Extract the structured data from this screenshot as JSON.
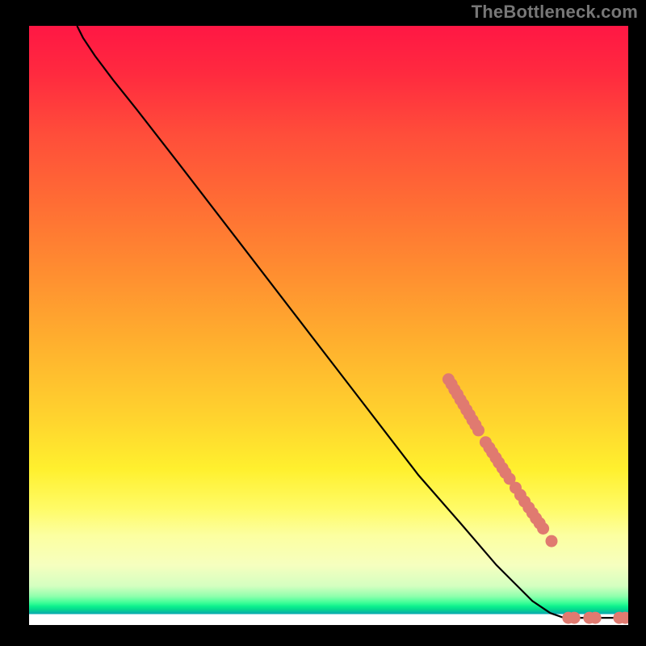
{
  "attribution": "TheBottleneck.com",
  "chart_data": {
    "type": "line",
    "title": "",
    "xlabel": "",
    "ylabel": "",
    "xlim": [
      0,
      100
    ],
    "ylim": [
      0,
      100
    ],
    "grid": false,
    "legend": false,
    "curve": [
      {
        "x": 8,
        "y": 100
      },
      {
        "x": 9,
        "y": 98
      },
      {
        "x": 11,
        "y": 95
      },
      {
        "x": 14,
        "y": 91
      },
      {
        "x": 18,
        "y": 86
      },
      {
        "x": 25,
        "y": 77
      },
      {
        "x": 35,
        "y": 64
      },
      {
        "x": 45,
        "y": 51
      },
      {
        "x": 55,
        "y": 38
      },
      {
        "x": 65,
        "y": 25
      },
      {
        "x": 72,
        "y": 17
      },
      {
        "x": 78,
        "y": 10
      },
      {
        "x": 84,
        "y": 4
      },
      {
        "x": 87,
        "y": 2
      },
      {
        "x": 89,
        "y": 1.3
      },
      {
        "x": 92,
        "y": 1.2
      },
      {
        "x": 96,
        "y": 1.2
      },
      {
        "x": 100,
        "y": 1.2
      }
    ],
    "dots": [
      {
        "x": 70.0,
        "y": 41.0
      },
      {
        "x": 70.5,
        "y": 40.2
      },
      {
        "x": 71.0,
        "y": 39.3
      },
      {
        "x": 71.5,
        "y": 38.5
      },
      {
        "x": 72.0,
        "y": 37.6
      },
      {
        "x": 72.5,
        "y": 36.8
      },
      {
        "x": 73.0,
        "y": 35.9
      },
      {
        "x": 73.5,
        "y": 35.1
      },
      {
        "x": 74.0,
        "y": 34.2
      },
      {
        "x": 74.5,
        "y": 33.4
      },
      {
        "x": 75.0,
        "y": 32.5
      },
      {
        "x": 76.2,
        "y": 30.5
      },
      {
        "x": 76.8,
        "y": 29.6
      },
      {
        "x": 77.3,
        "y": 28.8
      },
      {
        "x": 77.9,
        "y": 27.9
      },
      {
        "x": 78.4,
        "y": 27.1
      },
      {
        "x": 79.0,
        "y": 26.2
      },
      {
        "x": 79.5,
        "y": 25.4
      },
      {
        "x": 80.2,
        "y": 24.4
      },
      {
        "x": 81.2,
        "y": 22.9
      },
      {
        "x": 82.0,
        "y": 21.7
      },
      {
        "x": 82.7,
        "y": 20.6
      },
      {
        "x": 83.4,
        "y": 19.6
      },
      {
        "x": 84.0,
        "y": 18.7
      },
      {
        "x": 84.6,
        "y": 17.8
      },
      {
        "x": 85.2,
        "y": 17.0
      },
      {
        "x": 85.8,
        "y": 16.1
      },
      {
        "x": 87.2,
        "y": 14.0
      },
      {
        "x": 90.0,
        "y": 1.2
      },
      {
        "x": 91.0,
        "y": 1.2
      },
      {
        "x": 93.5,
        "y": 1.2
      },
      {
        "x": 94.5,
        "y": 1.2
      },
      {
        "x": 98.5,
        "y": 1.2
      },
      {
        "x": 99.5,
        "y": 1.2
      }
    ],
    "colors": {
      "dot": "#e07a70",
      "line": "#000000"
    }
  }
}
